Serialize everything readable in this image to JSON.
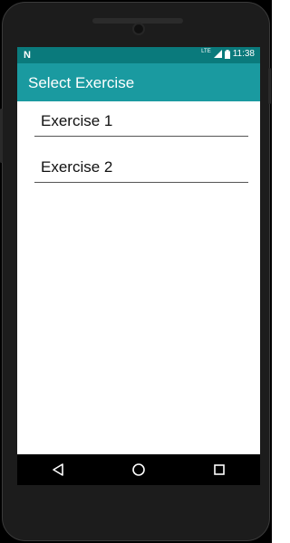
{
  "status_bar": {
    "left_icon": "notification-n-icon",
    "network": "LTE",
    "time": "11:38"
  },
  "app_bar": {
    "title": "Select Exercise"
  },
  "list": {
    "items": [
      {
        "label": "Exercise 1"
      },
      {
        "label": "Exercise 2"
      }
    ]
  },
  "nav_bar": {
    "back_icon": "back-icon",
    "home_icon": "home-icon",
    "recents_icon": "recents-icon"
  },
  "colors": {
    "status_bar": "#0a7a7c",
    "app_bar": "#1a9aa0",
    "nav_bar": "#000000"
  }
}
